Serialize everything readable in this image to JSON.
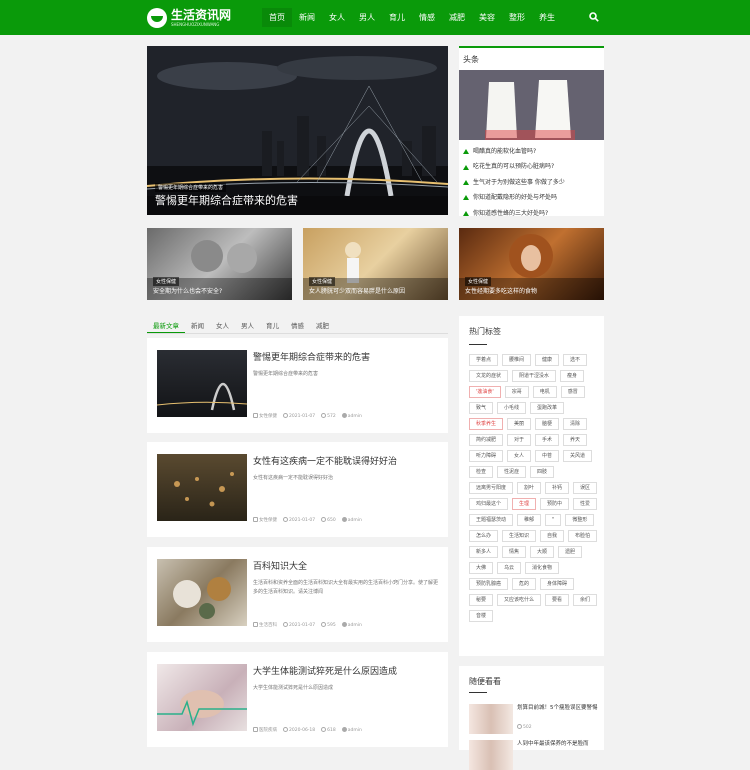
{
  "header": {
    "logo_text": "生活资讯网",
    "logo_sub": "SHENGHUOZIXUNWANG",
    "nav": [
      "首页",
      "新闻",
      "女人",
      "男人",
      "育儿",
      "情感",
      "减肥",
      "美容",
      "整形",
      "养生"
    ]
  },
  "hero": {
    "tag": "警惕更年期综合症带来的危害",
    "title": "警惕更年期综合症带来的危害"
  },
  "toutiao": {
    "title": "头条",
    "items": [
      "喝醋真的能软化血管吗?",
      "吃花生真的可以预防心脏病吗?",
      "生气对于为别做这些事 你做了多少",
      "你知道配戴隐形的好处与坏处吗",
      "你知道感性蜂的三大好处吗?"
    ]
  },
  "thumbs": [
    {
      "tag": "女性保健",
      "title": "安全期为什么也会不安全?"
    },
    {
      "tag": "女性保健",
      "title": "女人膀胱可少双而容易胖是什么原因"
    },
    {
      "tag": "女性保健",
      "title": "女性经期要多吃这样的食物"
    }
  ],
  "tabs": [
    "最新文章",
    "新闻",
    "女人",
    "男人",
    "育儿",
    "情感",
    "减肥"
  ],
  "articles": [
    {
      "title": "警惕更年期综合症带来的危害",
      "summary": "警惕更年期综合症带来的危害",
      "category": "女性保健",
      "date": "2021-01-07",
      "views": "572",
      "author": "admin"
    },
    {
      "title": "女性有这疾病一定不能耽误得好好治",
      "summary": "女性有这疾病一定不能耽误得好好治",
      "category": "女性保健",
      "date": "2021-01-07",
      "views": "650",
      "author": "admin"
    },
    {
      "title": "百科知识大全",
      "summary": "生活百科和资养全面的生活百科知识大全有最实用的生活百科小窍门分享。使了解更多的生活百科知识。请关注博闻",
      "category": "生活百科",
      "date": "2021-01-07",
      "views": "595",
      "author": "admin"
    },
    {
      "title": "大学生体能测试猝死是什么原因造成",
      "summary": "大学生体能测试猝死是什么原因造成",
      "category": "医院疾病",
      "date": "2020-06-18",
      "views": "618",
      "author": "admin"
    }
  ],
  "hot_tags": {
    "title": "热门标签",
    "items": [
      {
        "t": "学着点",
        "red": false
      },
      {
        "t": "腰椎间",
        "red": false
      },
      {
        "t": "健康",
        "red": false
      },
      {
        "t": "选不",
        "red": false
      },
      {
        "t": "文龙的症状",
        "red": false
      },
      {
        "t": "阴道干涩没水",
        "red": false
      },
      {
        "t": "瘦身",
        "red": false
      },
      {
        "t": "'莲油食'",
        "red": true
      },
      {
        "t": "宗哥",
        "red": false
      },
      {
        "t": "电机",
        "red": false
      },
      {
        "t": "感冒",
        "red": false
      },
      {
        "t": "致气",
        "red": false
      },
      {
        "t": "小毛线",
        "red": false
      },
      {
        "t": "蛋跑改革",
        "red": false
      },
      {
        "t": "秋季养生",
        "red": true
      },
      {
        "t": "美丽",
        "red": false
      },
      {
        "t": "脑梗",
        "red": false
      },
      {
        "t": "清除",
        "red": false
      },
      {
        "t": "简约减肥",
        "red": false
      },
      {
        "t": "对于",
        "red": false
      },
      {
        "t": "手术",
        "red": false
      },
      {
        "t": "养天",
        "red": false
      },
      {
        "t": "听力障碍",
        "red": false
      },
      {
        "t": "女人",
        "red": false
      },
      {
        "t": "中苍",
        "red": false
      },
      {
        "t": "关风道",
        "red": false
      },
      {
        "t": "检查",
        "red": false
      },
      {
        "t": "性泥症",
        "red": false
      },
      {
        "t": "四肢",
        "red": false
      },
      {
        "t": "远离男亏阳度",
        "red": false
      },
      {
        "t": "割叶",
        "red": false
      },
      {
        "t": "补钙",
        "red": false
      },
      {
        "t": "误区",
        "red": false
      },
      {
        "t": "鸡归最这个",
        "red": false
      },
      {
        "t": "生理",
        "red": true
      },
      {
        "t": "预防中",
        "red": false
      },
      {
        "t": "性爱",
        "red": false
      },
      {
        "t": "王题福瑟茨动",
        "red": false
      },
      {
        "t": "稚郁",
        "red": false
      },
      {
        "t": "\"",
        "red": false
      },
      {
        "t": "微整形",
        "red": false
      },
      {
        "t": "怎么办",
        "red": false
      },
      {
        "t": "生活知识",
        "red": false
      },
      {
        "t": "自我",
        "red": false
      },
      {
        "t": "布脸怕",
        "red": false
      },
      {
        "t": "新多人",
        "red": false
      },
      {
        "t": "情焦",
        "red": false
      },
      {
        "t": "大顺",
        "red": false
      },
      {
        "t": "遗胆",
        "red": false
      },
      {
        "t": "大佛",
        "red": false
      },
      {
        "t": "乌云",
        "red": false
      },
      {
        "t": "消化食物",
        "red": false
      },
      {
        "t": "预防乳腺癌",
        "red": false
      },
      {
        "t": "危的",
        "red": false
      },
      {
        "t": "身体障碍",
        "red": false
      },
      {
        "t": "秘要",
        "red": false
      },
      {
        "t": "又应该吃什么",
        "red": false
      },
      {
        "t": "要看",
        "red": false
      },
      {
        "t": "余们",
        "red": false
      },
      {
        "t": "音楼",
        "red": false
      }
    ]
  },
  "random": {
    "title": "随便看看",
    "items": [
      {
        "title": "划算目前城！5个瘦脸误区要警惕",
        "views": "502"
      },
      {
        "title": "人到中年最该保养的不是脸而"
      }
    ]
  },
  "colors": {
    "brand": "#0a9a0a",
    "tag_red": "#e04646"
  },
  "icons": [
    "search-icon",
    "folder-icon",
    "clock-icon",
    "eye-icon",
    "user-icon",
    "triangle-icon"
  ]
}
